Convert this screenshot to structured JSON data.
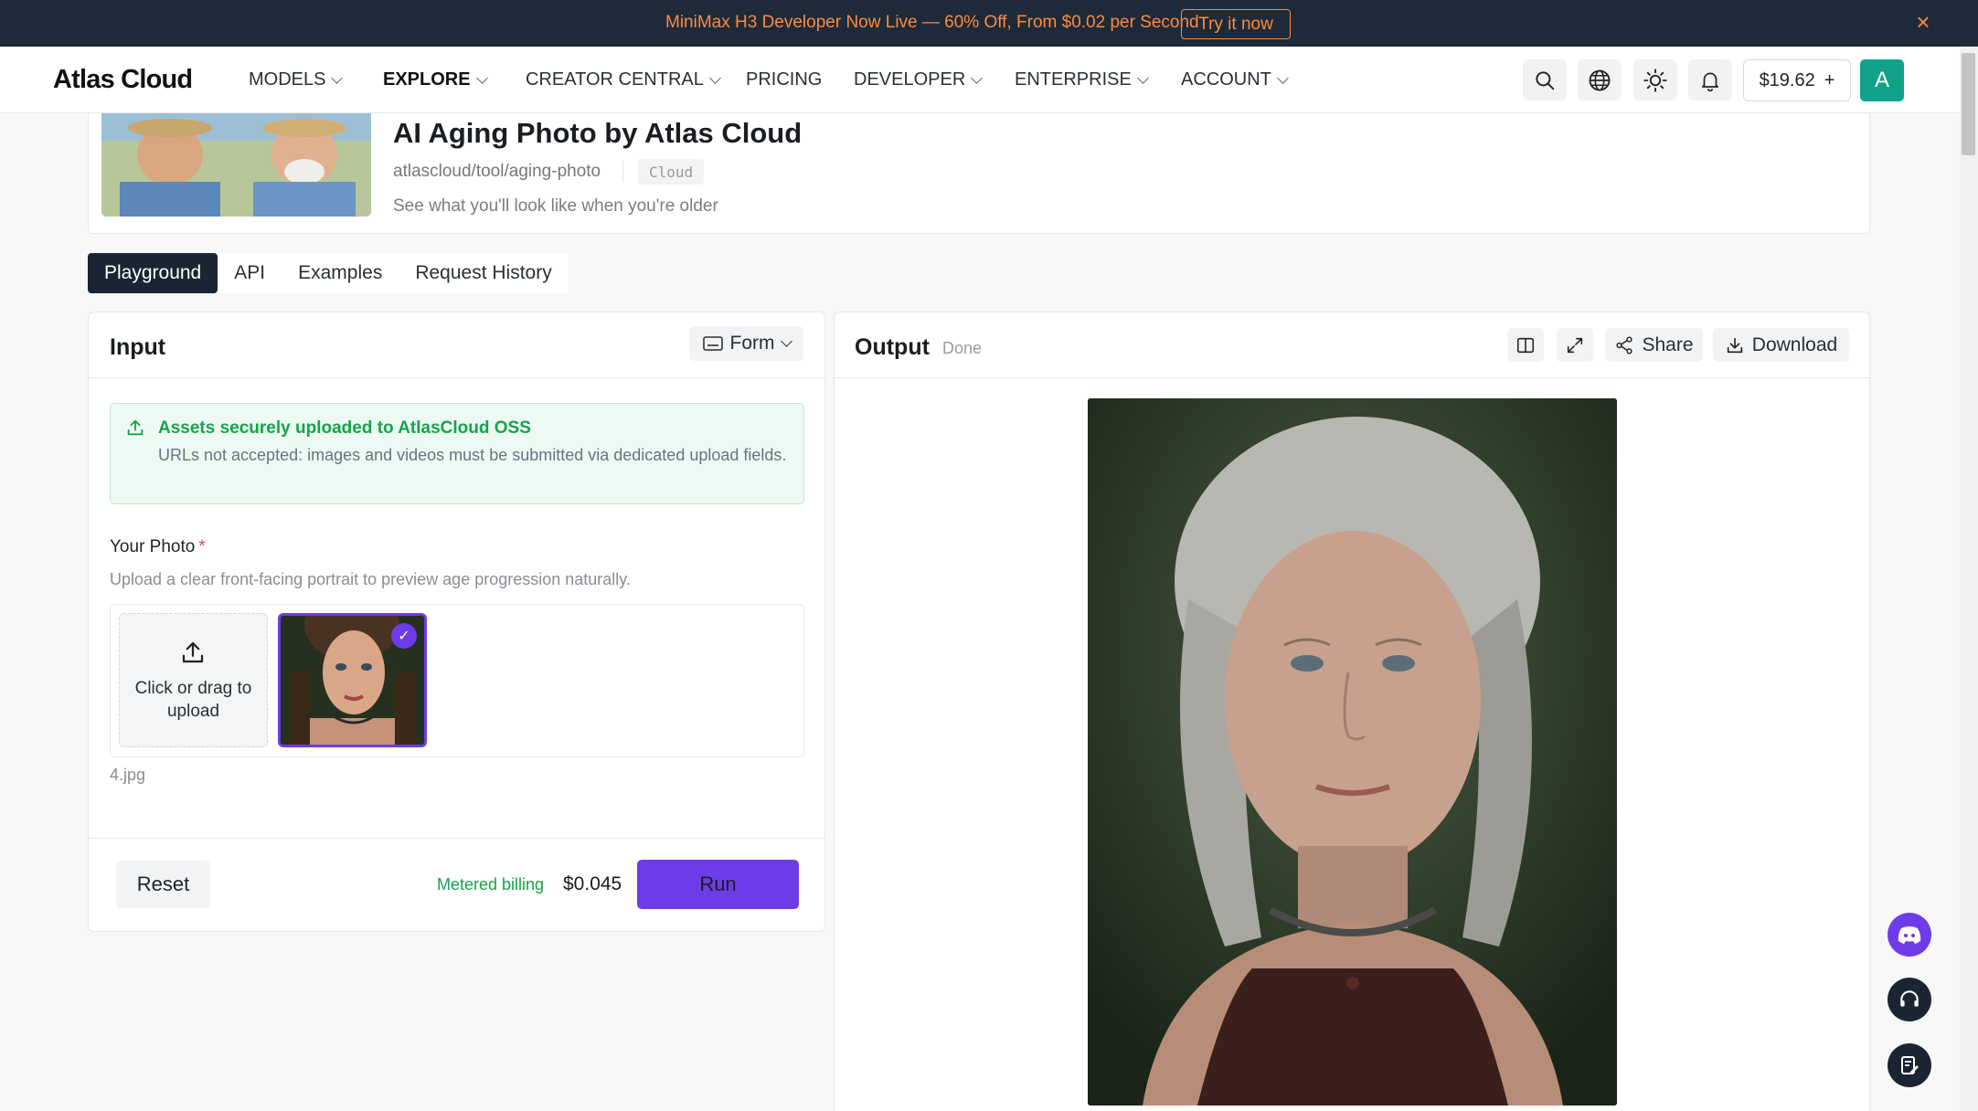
{
  "banner": {
    "text": "MiniMax H3 Developer Now Live — 60% Off, From $0.02 per Second",
    "cta": "Try it now",
    "close": "×"
  },
  "nav": {
    "logo": "Atlas Cloud",
    "items": [
      {
        "label": "MODELS",
        "dropdown": true
      },
      {
        "label": "EXPLORE",
        "dropdown": true,
        "active": true
      },
      {
        "label": "CREATOR CENTRAL",
        "dropdown": true
      },
      {
        "label": "PRICING",
        "dropdown": false
      },
      {
        "label": "DEVELOPER",
        "dropdown": true
      },
      {
        "label": "ENTERPRISE",
        "dropdown": true
      },
      {
        "label": "ACCOUNT",
        "dropdown": true
      }
    ],
    "icons": [
      "search-icon",
      "globe-icon",
      "sun-icon",
      "bell-icon"
    ],
    "balance": "$19.62",
    "balance_plus": "+",
    "avatar": "A"
  },
  "header": {
    "title": "AI Aging Photo by Atlas Cloud",
    "slug": "atlascloud/tool/aging-photo",
    "tag": "Cloud",
    "description": "See what you'll look like when you're older"
  },
  "tabs": [
    {
      "label": "Playground",
      "active": true
    },
    {
      "label": "API",
      "active": false
    },
    {
      "label": "Examples",
      "active": false
    },
    {
      "label": "Request History",
      "active": false
    }
  ],
  "input": {
    "title": "Input",
    "mode": "Form",
    "notice_title": "Assets securely uploaded to AtlasCloud OSS",
    "notice_body": "URLs not accepted: images and videos must be submitted via dedicated upload fields.",
    "photo_label": "Your Photo",
    "required_mark": "*",
    "photo_help": "Upload a clear front-facing portrait to preview age progression naturally.",
    "upload_text": "Click or drag to upload",
    "file_name": "4.jpg",
    "reset": "Reset",
    "billing_label": "Metered billing",
    "price": "$0.045",
    "run": "Run"
  },
  "output": {
    "title": "Output",
    "status": "Done",
    "share": "Share",
    "download": "Download"
  },
  "colors": {
    "accent": "#6d3ce8",
    "success": "#16a34a",
    "banner_bg": "#1e2a39",
    "banner_fg": "#ff8a3d",
    "avatar_bg": "#11a38a"
  }
}
